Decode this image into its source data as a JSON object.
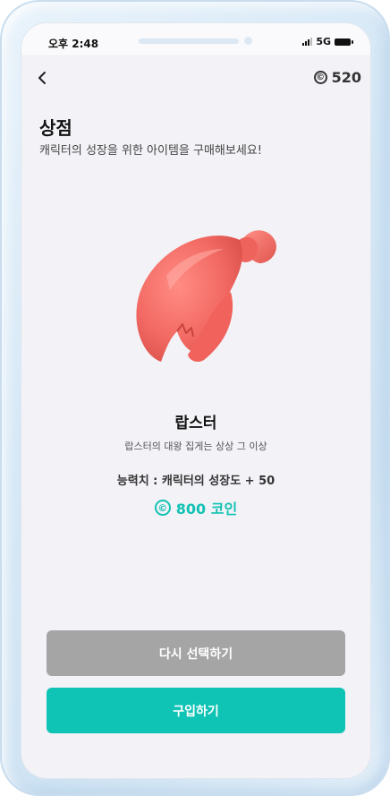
{
  "status_bar": {
    "time": "오후 2:48",
    "network": "5G"
  },
  "header": {
    "back_icon": "chevron-left-icon",
    "coin_icon": "coin-icon",
    "coin_symbol": "©",
    "coin_balance": "520"
  },
  "page": {
    "title": "상점",
    "subtitle": "캐릭터의 성장을 위한 아이템을 구매해보세요!"
  },
  "item": {
    "image_icon": "lobster-claw-icon",
    "name": "랍스터",
    "description": "랍스터의 대왕 집게는 상상 그 이상",
    "ability": "능력치 : 캐릭터의 성장도 + 50",
    "price_symbol": "©",
    "price": "800 코인"
  },
  "buttons": {
    "reselect_label": "다시 선택하기",
    "buy_label": "구입하기"
  },
  "colors": {
    "accent": "#10c4b5",
    "reselect_button": "#a5a5a5",
    "background": "#f3f2f7",
    "claw": "#f26a63"
  }
}
